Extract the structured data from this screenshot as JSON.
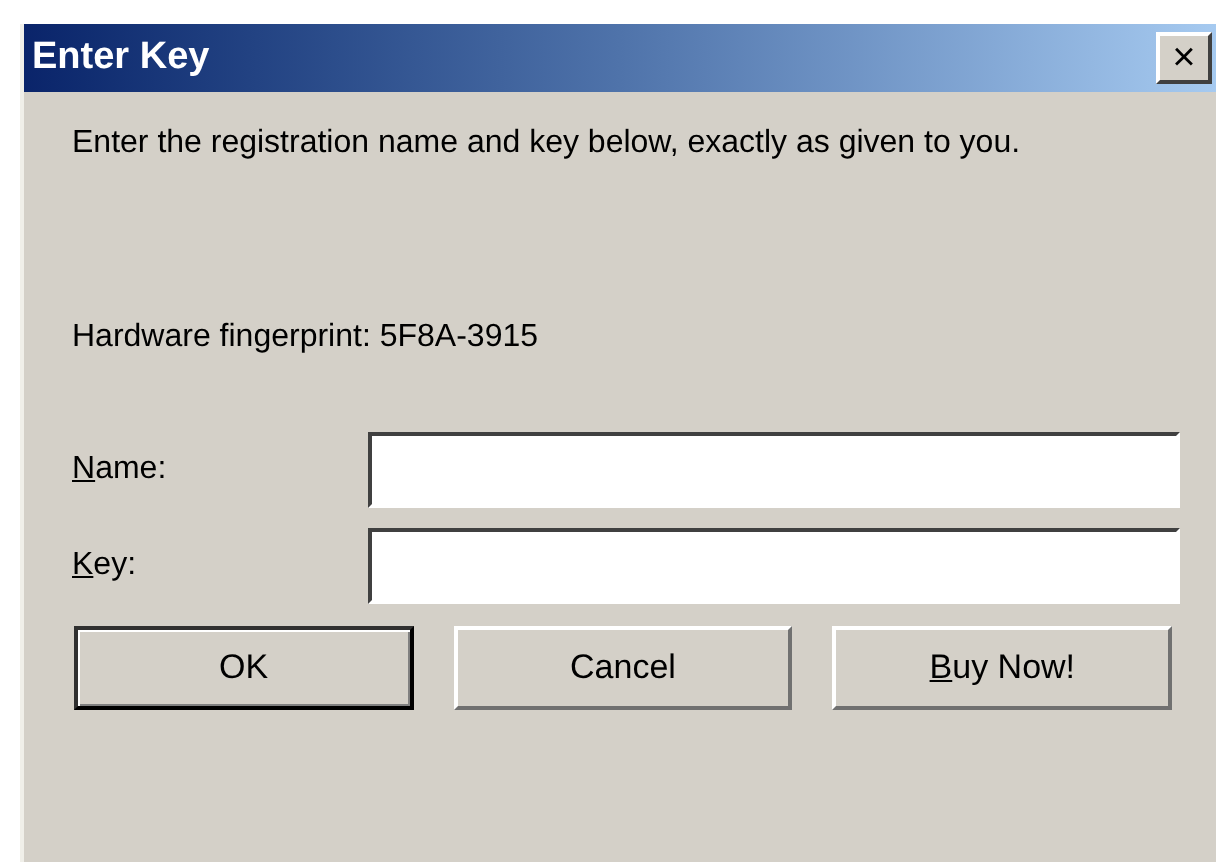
{
  "window": {
    "title": "Enter Key",
    "close": "×"
  },
  "message": "Enter the registration name and key below, exactly as given to you.",
  "fingerprint": "Hardware fingerprint: 5F8A-3915",
  "fields": [
    {
      "label": "Name:",
      "underline_first": true
    },
    {
      "label": "Key:",
      "underline_first": true
    }
  ],
  "buttons": [
    {
      "label": "OK",
      "default": true,
      "underline_first": false
    },
    {
      "label": "Cancel",
      "default": false,
      "underline_first": false
    },
    {
      "label": "Buy Now!",
      "default": false,
      "underline_first": true
    }
  ]
}
